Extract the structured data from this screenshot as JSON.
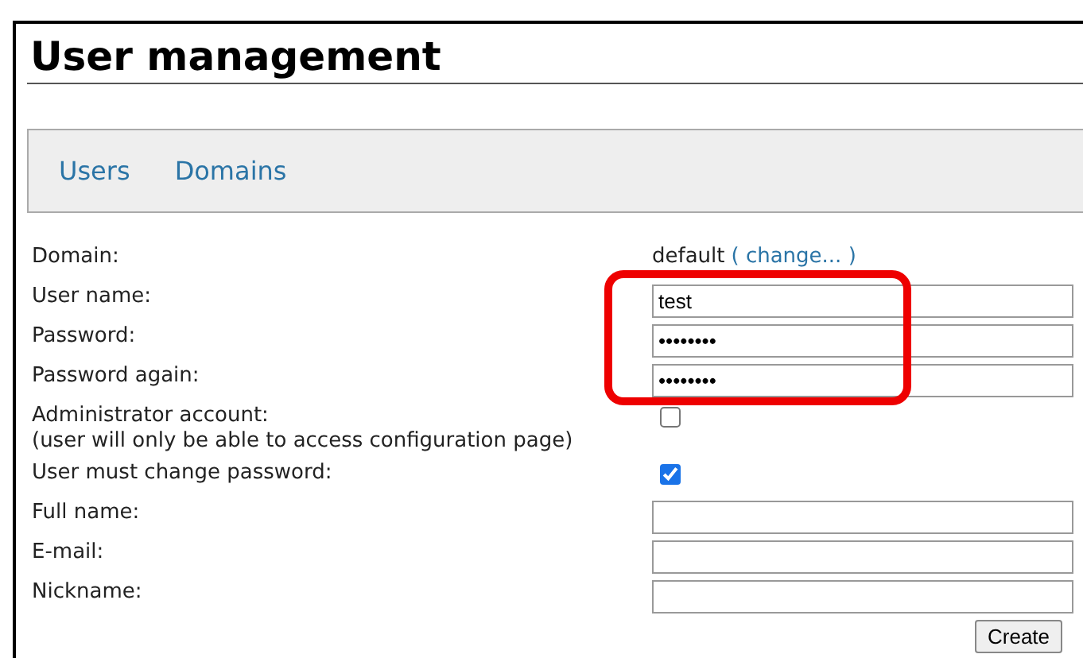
{
  "title": "User management",
  "nav": [
    {
      "label": "Users"
    },
    {
      "label": "Domains"
    }
  ],
  "fields": [
    {
      "kind": "info",
      "label": "Domain:",
      "value": "default",
      "link": "( change... )"
    },
    {
      "kind": "text",
      "label": "User name:",
      "value": "test"
    },
    {
      "kind": "text",
      "label": "Password:",
      "value": "••••••••"
    },
    {
      "kind": "text",
      "label": "Password again:",
      "value": "••••••••"
    },
    {
      "kind": "checkbox",
      "label": "Administrator account:",
      "note": "(user will only be able to access configuration page)",
      "checked": false
    },
    {
      "kind": "checkbox",
      "label": "User must change password:",
      "checked": true
    },
    {
      "kind": "text",
      "label": "Full name:"
    },
    {
      "kind": "text",
      "label": "E-mail:"
    },
    {
      "kind": "text",
      "label": "Nickname:"
    }
  ],
  "button": "Create"
}
